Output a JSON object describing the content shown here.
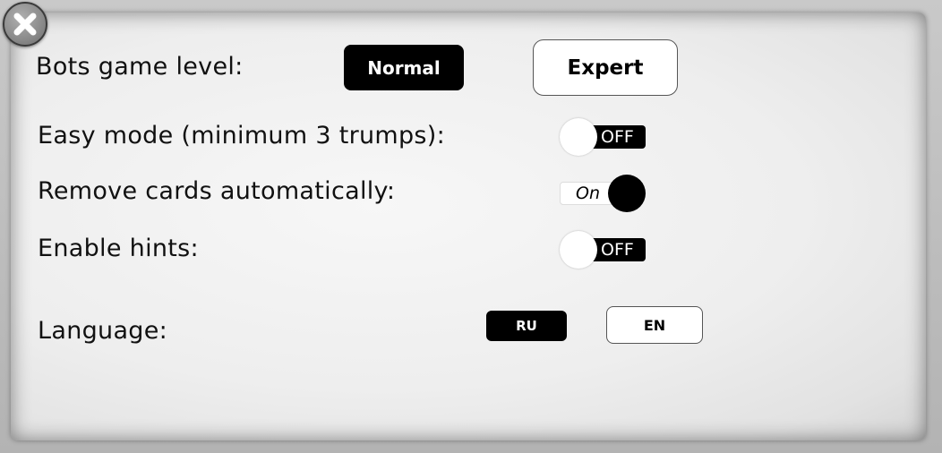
{
  "settings": {
    "bots_level": {
      "label": "Bots game level:",
      "options": [
        "Normal",
        "Expert"
      ],
      "selected": "Normal"
    },
    "easy_mode": {
      "label": "Easy mode (minimum 3 trumps):",
      "state": "OFF"
    },
    "remove_cards": {
      "label": "Remove cards automatically:",
      "state": "On"
    },
    "hints": {
      "label": "Enable hints:",
      "state": "OFF"
    },
    "language": {
      "label": "Language:",
      "options": [
        "RU",
        "EN"
      ],
      "selected": "RU"
    }
  },
  "icons": {
    "close": "close-icon"
  },
  "colors": {
    "selected_bg": "#000000",
    "unselected_bg": "#ffffff",
    "panel_bg": "#efefef"
  }
}
